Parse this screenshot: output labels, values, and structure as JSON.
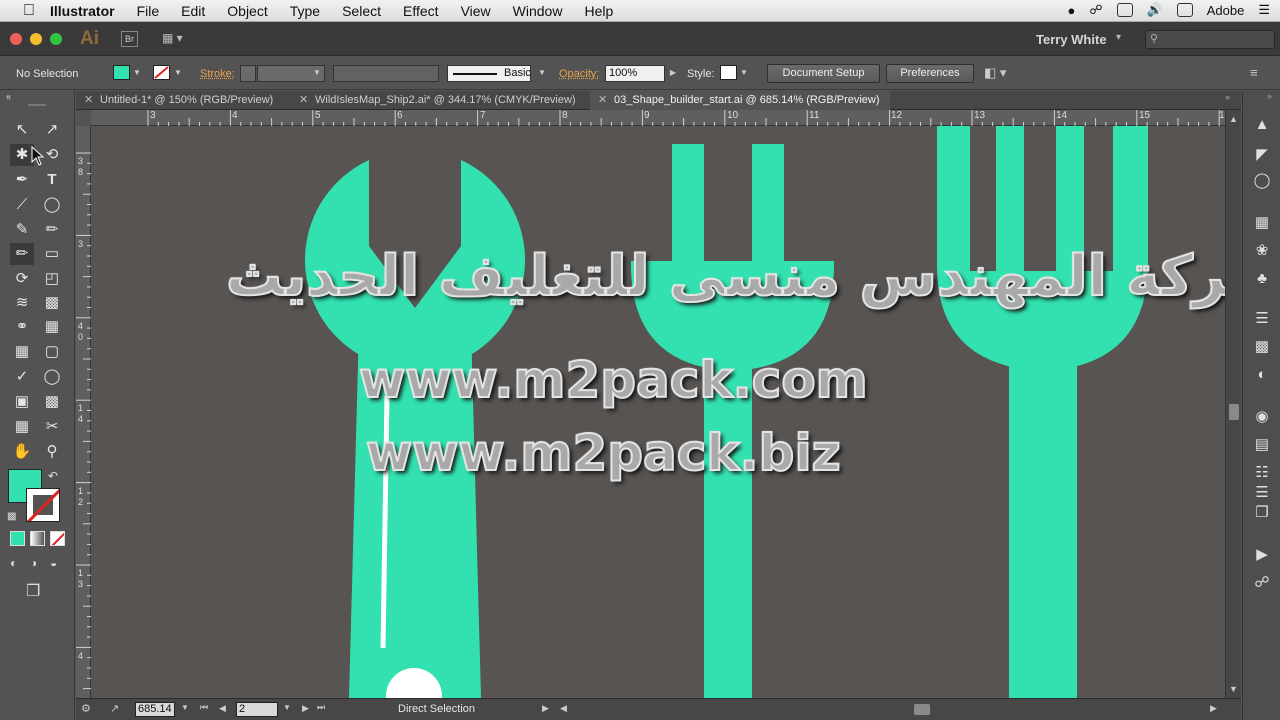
{
  "menubar": {
    "app": "Illustrator",
    "items": [
      "File",
      "Edit",
      "Object",
      "Type",
      "Select",
      "Effect",
      "View",
      "Window",
      "Help"
    ],
    "right_label": "Adobe"
  },
  "appbar": {
    "logo": "Ai",
    "bridge": "Br",
    "user": "Terry White"
  },
  "control": {
    "selection": "No Selection",
    "fill_color": "#33e1b0",
    "stroke_label": "Stroke:",
    "stroke_style": "Basic",
    "opacity_label": "Opacity:",
    "opacity_value": "100%",
    "style_label": "Style:",
    "document_setup": "Document Setup",
    "preferences": "Preferences"
  },
  "tabs": [
    {
      "label": "Untitled-1* @ 150% (RGB/Preview)",
      "active": false
    },
    {
      "label": "WildIslesMap_Ship2.ai* @ 344.17% (CMYK/Preview)",
      "active": false
    },
    {
      "label": "03_Shape_builder_start.ai @ 685.14% (RGB/Preview)",
      "active": true
    }
  ],
  "ruler": {
    "h": [
      "3",
      "4",
      "5",
      "6",
      "7",
      "8",
      "9",
      "10",
      "11",
      "12",
      "13",
      "14",
      "15",
      "1"
    ],
    "v": [
      "3",
      "8",
      "3",
      "4",
      "0",
      "1",
      "4",
      "1",
      "2",
      "1",
      "3",
      "4"
    ]
  },
  "status": {
    "zoom": "685.14",
    "artboard": "2",
    "tool": "Direct Selection"
  },
  "watermark": {
    "arabic": "شركة المهندس منسى للتغليف الحديث",
    "url1": "www.m2pack.com",
    "url2": "www.m2pack.biz"
  },
  "colors": {
    "artwork": "#33e1b0",
    "canvas": "#575452"
  },
  "icons": {
    "apple": "apple-icon",
    "search": "search-icon",
    "wifi": "wifi-icon",
    "menu": "list-icon"
  }
}
